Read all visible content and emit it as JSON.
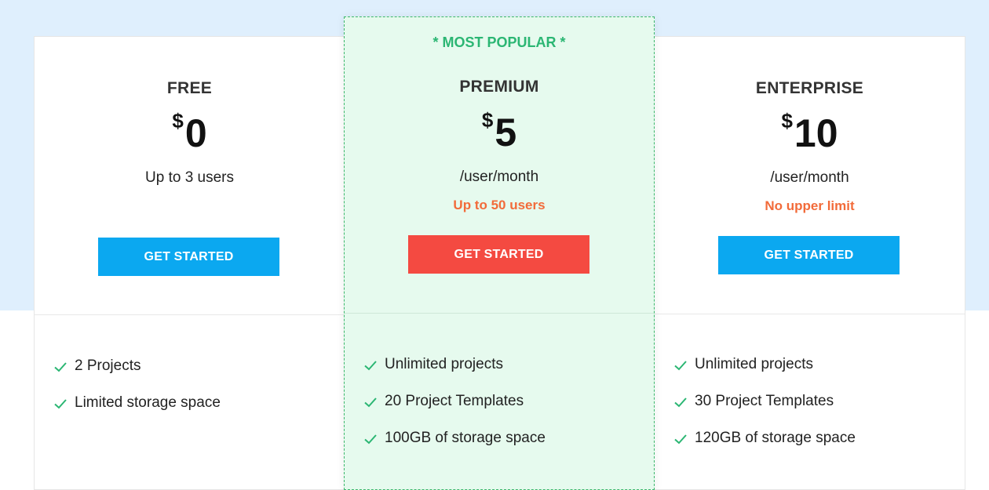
{
  "plans": [
    {
      "name": "FREE",
      "currency": "$",
      "price": "0",
      "subtext": "Up to 3 users",
      "limit": "",
      "button_label": "GET STARTED",
      "button_color": "#0ba8f0",
      "features": [
        "2 Projects",
        "Limited storage space"
      ]
    },
    {
      "badge": "* MOST POPULAR *",
      "name": "PREMIUM",
      "currency": "$",
      "price": "5",
      "subtext": "/user/month",
      "limit": "Up to 50 users",
      "button_label": "GET STARTED",
      "button_color": "#f44a41",
      "features": [
        "Unlimited projects",
        "20 Project Templates",
        "100GB of storage space"
      ]
    },
    {
      "name": "ENTERPRISE",
      "currency": "$",
      "price": "10",
      "subtext": "/user/month",
      "limit": "No upper limit",
      "button_label": "GET STARTED",
      "button_color": "#0ba8f0",
      "features": [
        "Unlimited projects",
        "30 Project Templates",
        "120GB of storage space"
      ]
    }
  ],
  "icons": {
    "feature_bullet": "check-icon"
  },
  "colors": {
    "accent_green": "#2bb673",
    "limit_orange": "#f26b3a",
    "top_band": "#dfeffd"
  }
}
